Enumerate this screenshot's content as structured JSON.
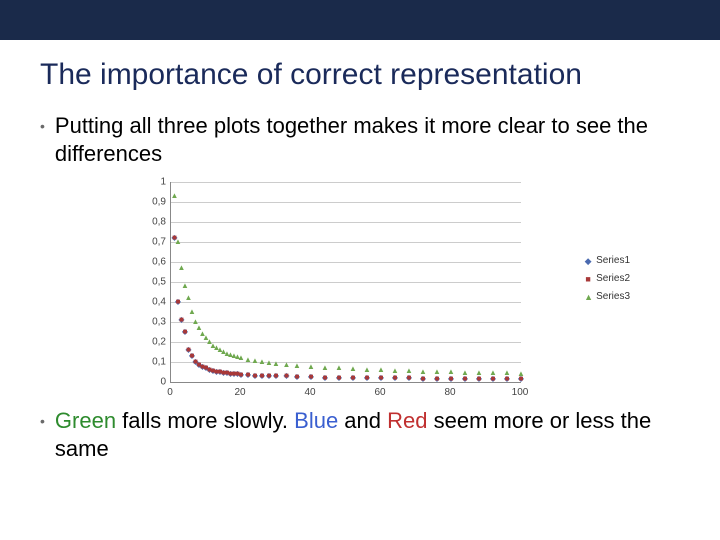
{
  "slide": {
    "title": "The importance of correct representation",
    "bullets": {
      "b1": "Putting all three plots together makes it more clear to see the differences",
      "b2_green": "Green",
      "b2_mid1": " falls more slowly. ",
      "b2_blue": "Blue",
      "b2_mid2": " and ",
      "b2_red": "Red",
      "b2_tail": " seem more or less the same"
    }
  },
  "chart_data": {
    "type": "scatter",
    "title": "",
    "xlabel": "",
    "ylabel": "",
    "xlim": [
      0,
      100
    ],
    "ylim": [
      0,
      1
    ],
    "x_ticks": [
      "0",
      "20",
      "40",
      "60",
      "80",
      "100"
    ],
    "y_ticks": [
      "0",
      "0,1",
      "0,2",
      "0,3",
      "0,4",
      "0,5",
      "0,6",
      "0,7",
      "0,8",
      "0,9",
      "1"
    ],
    "legend": {
      "items": [
        {
          "name": "Series1",
          "marker": "diamond",
          "color": "#4a6ab0"
        },
        {
          "name": "Series2",
          "marker": "square",
          "color": "#a83838"
        },
        {
          "name": "Series3",
          "marker": "triangle",
          "color": "#6fa84f"
        }
      ],
      "position": "right"
    },
    "x": [
      1,
      2,
      3,
      4,
      5,
      6,
      7,
      8,
      9,
      10,
      11,
      12,
      13,
      14,
      15,
      16,
      17,
      18,
      19,
      20,
      22,
      24,
      26,
      28,
      30,
      33,
      36,
      40,
      44,
      48,
      52,
      56,
      60,
      64,
      68,
      72,
      76,
      80,
      84,
      88,
      92,
      96,
      100
    ],
    "series": [
      {
        "name": "Series1",
        "values": [
          0.72,
          0.4,
          0.31,
          0.25,
          0.16,
          0.13,
          0.1,
          0.085,
          0.075,
          0.07,
          0.06,
          0.055,
          0.05,
          0.048,
          0.045,
          0.043,
          0.04,
          0.04,
          0.038,
          0.036,
          0.034,
          0.032,
          0.03,
          0.029,
          0.028,
          0.028,
          0.024,
          0.023,
          0.022,
          0.021,
          0.02,
          0.019,
          0.019,
          0.018,
          0.018,
          0.017,
          0.017,
          0.016,
          0.016,
          0.015,
          0.015,
          0.015,
          0.014
        ]
      },
      {
        "name": "Series2",
        "values": [
          0.72,
          0.4,
          0.31,
          0.25,
          0.16,
          0.13,
          0.1,
          0.085,
          0.075,
          0.07,
          0.06,
          0.055,
          0.05,
          0.048,
          0.045,
          0.043,
          0.04,
          0.04,
          0.038,
          0.036,
          0.034,
          0.032,
          0.03,
          0.029,
          0.028,
          0.028,
          0.024,
          0.023,
          0.022,
          0.021,
          0.02,
          0.019,
          0.019,
          0.018,
          0.018,
          0.017,
          0.017,
          0.016,
          0.016,
          0.015,
          0.015,
          0.015,
          0.014
        ]
      },
      {
        "name": "Series3",
        "values": [
          0.93,
          0.7,
          0.57,
          0.48,
          0.42,
          0.35,
          0.3,
          0.27,
          0.24,
          0.22,
          0.2,
          0.18,
          0.17,
          0.16,
          0.15,
          0.14,
          0.135,
          0.13,
          0.125,
          0.12,
          0.11,
          0.105,
          0.1,
          0.095,
          0.09,
          0.085,
          0.08,
          0.075,
          0.07,
          0.068,
          0.065,
          0.06,
          0.058,
          0.055,
          0.053,
          0.05,
          0.05,
          0.048,
          0.047,
          0.045,
          0.044,
          0.043,
          0.042
        ]
      }
    ]
  }
}
